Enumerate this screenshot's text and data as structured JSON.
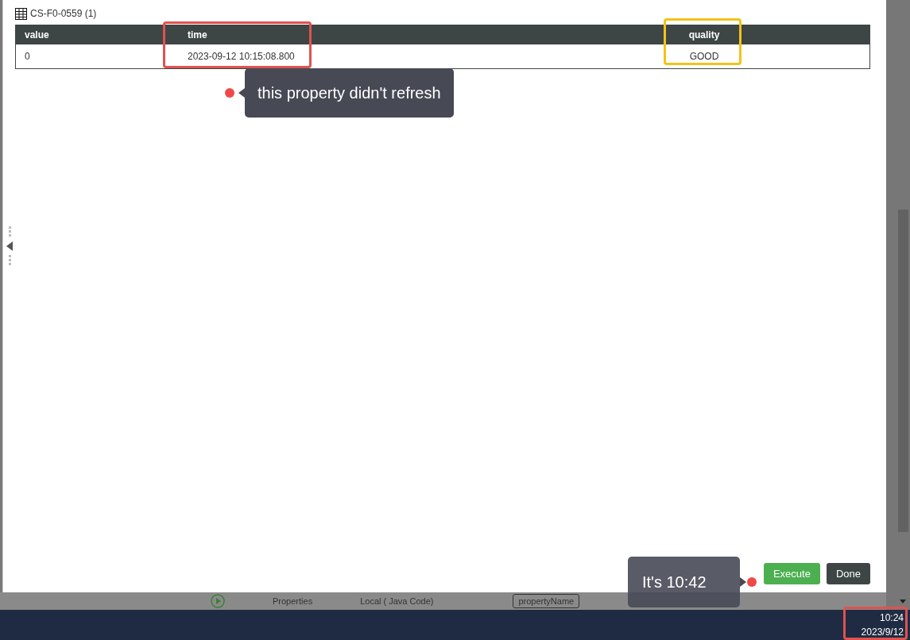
{
  "panel": {
    "title": "CS-F0-0559 (1)"
  },
  "table": {
    "columns": [
      {
        "label": "value"
      },
      {
        "label": "time",
        "color": "#e0524f"
      },
      {
        "label": "quality",
        "color": "#f2c318"
      }
    ],
    "rows": [
      [
        "0",
        "2023-09-12 10:15:08.800",
        "GOOD"
      ]
    ]
  },
  "annotations": [
    {
      "kind": "callout",
      "text": "this property didn't refresh"
    },
    {
      "kind": "callout",
      "text": "It's 10:42"
    }
  ],
  "dialog_buttons": [
    {
      "label": "Execute",
      "kind": "primary"
    },
    {
      "label": "Done",
      "kind": "secondary"
    }
  ],
  "background_strip": [
    "Properties",
    "Local ( Java Code)",
    "propertyName"
  ],
  "taskbar": {
    "time": "10:24",
    "date": "2023/9/12"
  }
}
